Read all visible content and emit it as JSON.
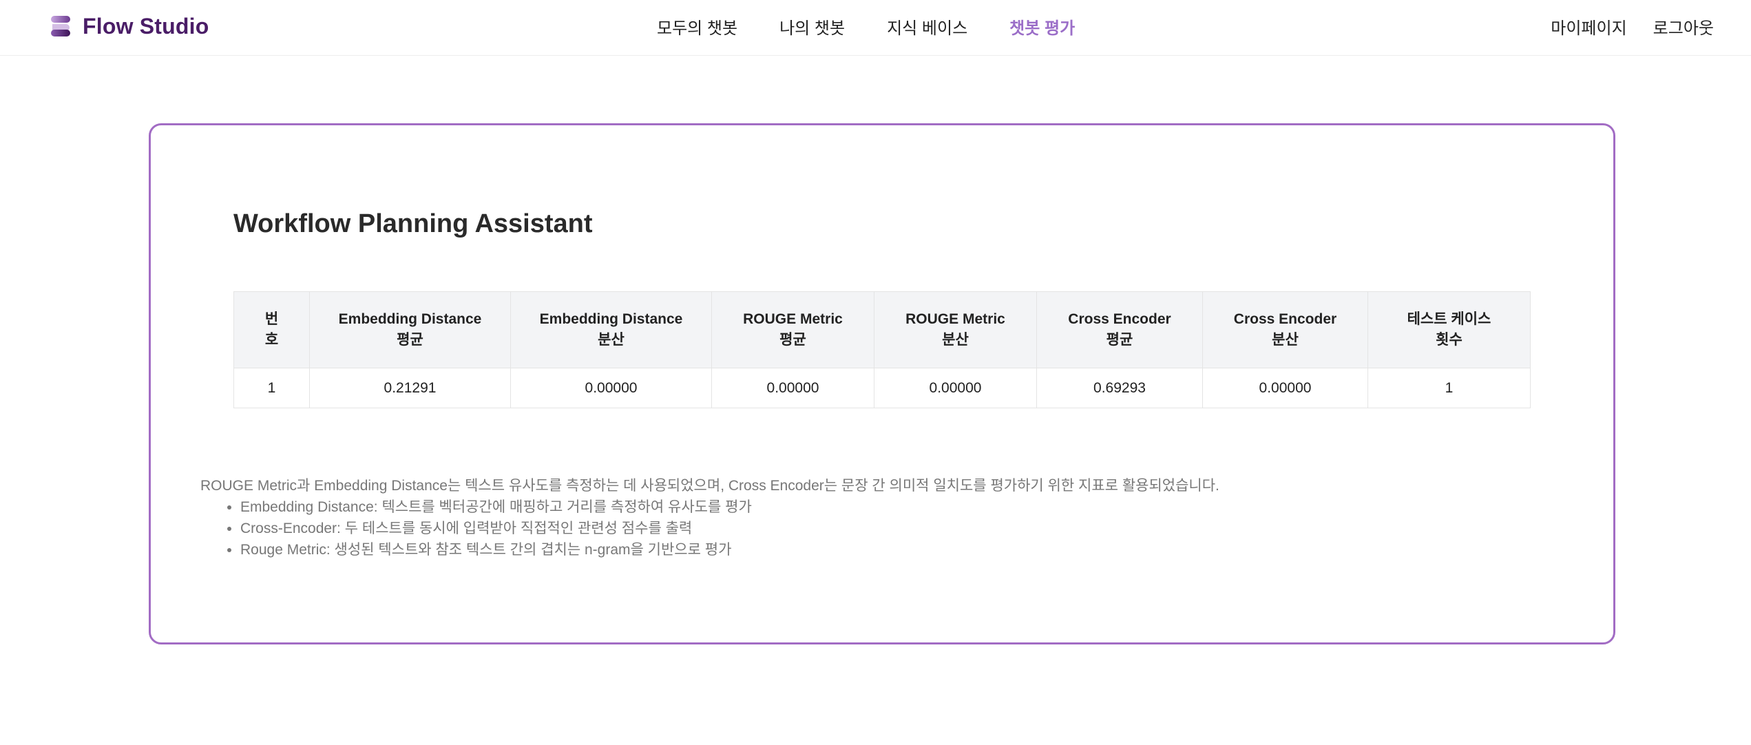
{
  "app": {
    "brand_name": "Flow Studio",
    "accent_color": "#9b6ec8",
    "brand_color": "#4a1d67",
    "card_border_color": "#a26cc4",
    "logo_icon": "stacked-layers-logo-icon"
  },
  "nav": {
    "items": [
      {
        "label": "모두의 챗봇",
        "active": false
      },
      {
        "label": "나의 챗봇",
        "active": false
      },
      {
        "label": "지식 베이스",
        "active": false
      },
      {
        "label": "챗봇 평가",
        "active": true
      }
    ]
  },
  "user_menu": {
    "mypage": "마이페이지",
    "logout": "로그아웃"
  },
  "main": {
    "title": "Workflow Planning Assistant",
    "table": {
      "headers": [
        [
          "번",
          "호"
        ],
        [
          "Embedding Distance",
          "평균"
        ],
        [
          "Embedding Distance",
          "분산"
        ],
        [
          "ROUGE Metric",
          "평균"
        ],
        [
          "ROUGE Metric",
          "분산"
        ],
        [
          "Cross Encoder",
          "평균"
        ],
        [
          "Cross Encoder",
          "분산"
        ],
        [
          "테스트 케이스",
          "횟수"
        ]
      ],
      "rows": [
        [
          "1",
          "0.21291",
          "0.00000",
          "0.00000",
          "0.00000",
          "0.69293",
          "0.00000",
          "1"
        ]
      ]
    },
    "notes": {
      "intro": "ROUGE Metric과 Embedding Distance는 텍스트 유사도를 측정하는 데 사용되었으며, Cross Encoder는 문장 간 의미적 일치도를 평가하기 위한 지표로 활용되었습니다.",
      "items": [
        "Embedding Distance: 텍스트를 벡터공간에 매핑하고 거리를 측정하여 유사도를 평가",
        "Cross-Encoder: 두 테스트를 동시에 입력받아 직접적인 관련성 점수를 출력",
        "Rouge Metric: 생성된 텍스트와 참조 텍스트 간의 겹치는 n-gram을 기반으로 평가"
      ]
    }
  }
}
